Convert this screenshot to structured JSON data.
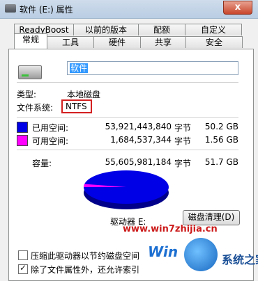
{
  "window": {
    "title": "软件 (E:) 属性",
    "close_label": "x"
  },
  "tabs": {
    "row1": [
      "ReadyBoost",
      "以前的版本",
      "配额",
      "自定义"
    ],
    "row2": [
      "常规",
      "工具",
      "硬件",
      "共享",
      "安全"
    ],
    "active": "常规"
  },
  "general": {
    "name_value": "软件",
    "type_label": "类型:",
    "type_value": "本地磁盘",
    "fs_label": "文件系统:",
    "fs_value": "NTFS",
    "used_label": "已用空间:",
    "used_bytes": "53,921,443,840",
    "used_unit": "字节",
    "used_size": "50.2 GB",
    "free_label": "可用空间:",
    "free_bytes": "1,684,537,344",
    "free_unit": "字节",
    "free_size": "1.56 GB",
    "capacity_label": "容量:",
    "capacity_bytes": "55,605,981,184",
    "capacity_unit": "字节",
    "capacity_size": "51.7 GB",
    "drive_label": "驱动器 E:",
    "clean_button": "磁盘清理(D)",
    "compress_label": "压缩此驱动器以节约磁盘空间",
    "compress_checked": false,
    "index_label": "除了文件属性外，还允许索引",
    "index_checked": true,
    "used_fraction": 0.97,
    "used_color": "#0000e6",
    "free_color": "#ff00ff"
  },
  "watermark": {
    "url": "www.win7zhijia.cn",
    "brand_prefix": "Win",
    "brand": "系统之家"
  }
}
